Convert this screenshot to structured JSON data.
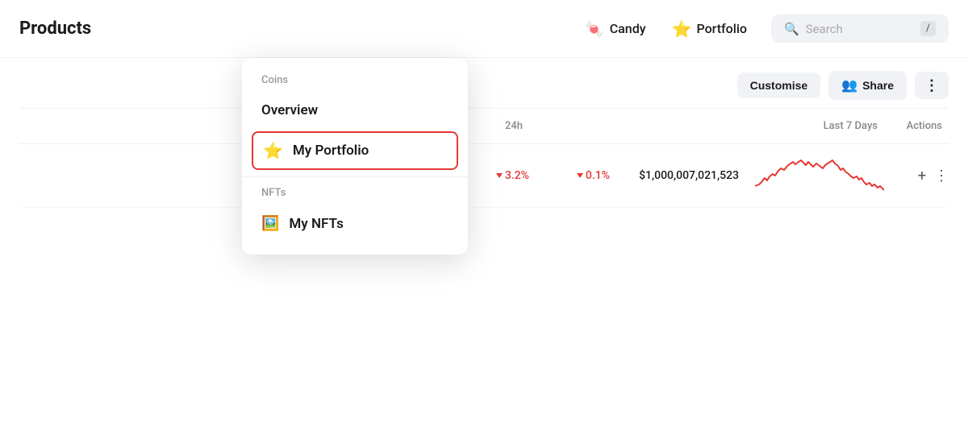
{
  "navbar": {
    "logo": "Products",
    "candy_label": "Candy",
    "candy_icon": "🍬",
    "portfolio_label": "Portfolio",
    "portfolio_icon": "⭐",
    "search_placeholder": "Search",
    "search_slash": "/"
  },
  "dropdown": {
    "coins_section": "Coins",
    "overview_label": "Overview",
    "my_portfolio_label": "My Portfolio",
    "my_portfolio_icon": "⭐",
    "nfts_section": "NFTs",
    "my_nfts_label": "My NFTs"
  },
  "toolbar": {
    "customise_label": "Customise",
    "share_label": "Share",
    "more_dots": "⋮"
  },
  "table": {
    "headers": {
      "col_24h": "24h",
      "col_last7days": "Last 7 Days",
      "col_actions": "Actions"
    },
    "row": {
      "change_24h": "3.2%",
      "change_7d": "0.1%",
      "price": "$1,000,007,021,523",
      "plus": "+",
      "more": "⋮"
    }
  },
  "colors": {
    "accent_red": "#e53935",
    "bg": "#ffffff",
    "muted": "#888888"
  }
}
